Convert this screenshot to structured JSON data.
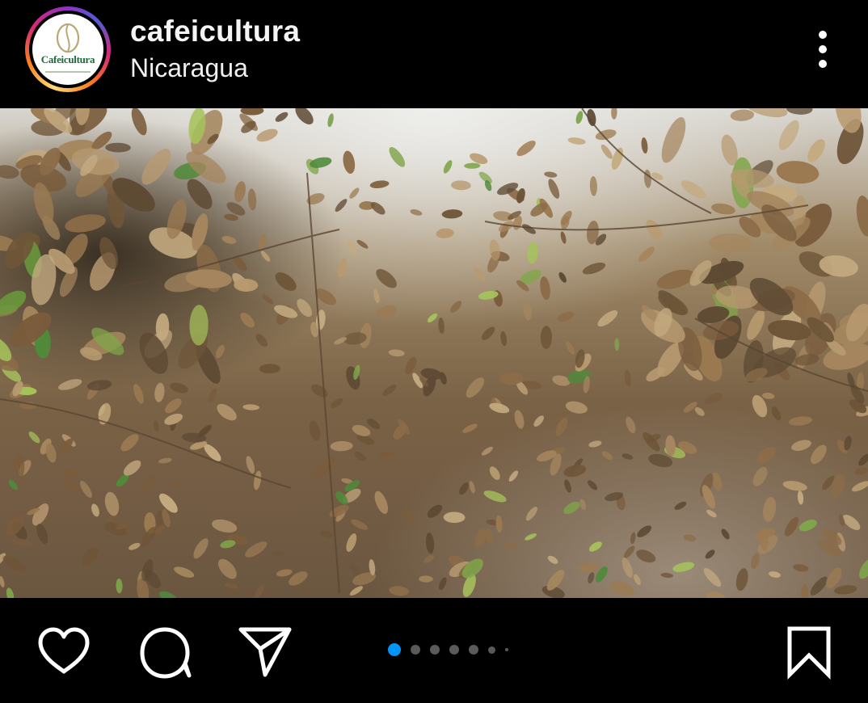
{
  "header": {
    "username": "cafeicultura",
    "location": "Nicaragua",
    "avatar_brand": "Cafeicultura",
    "avatar_icon": "coffee-bean-logo",
    "more_icon": "more-vertical-icon"
  },
  "post": {
    "image_subject": "dried brown coffee plant leaves",
    "carousel": {
      "total_dots": 7,
      "active_index": 0,
      "active_color": "#0095f6",
      "inactive_color": "#5a5a5a"
    }
  },
  "actions": {
    "like_icon": "heart-icon",
    "comment_icon": "comment-icon",
    "share_icon": "send-icon",
    "save_icon": "bookmark-icon"
  },
  "colors": {
    "background": "#000000",
    "text": "#ffffff",
    "story_ring": [
      "#feda75",
      "#fa7e1e",
      "#d62976",
      "#962fbf"
    ]
  }
}
